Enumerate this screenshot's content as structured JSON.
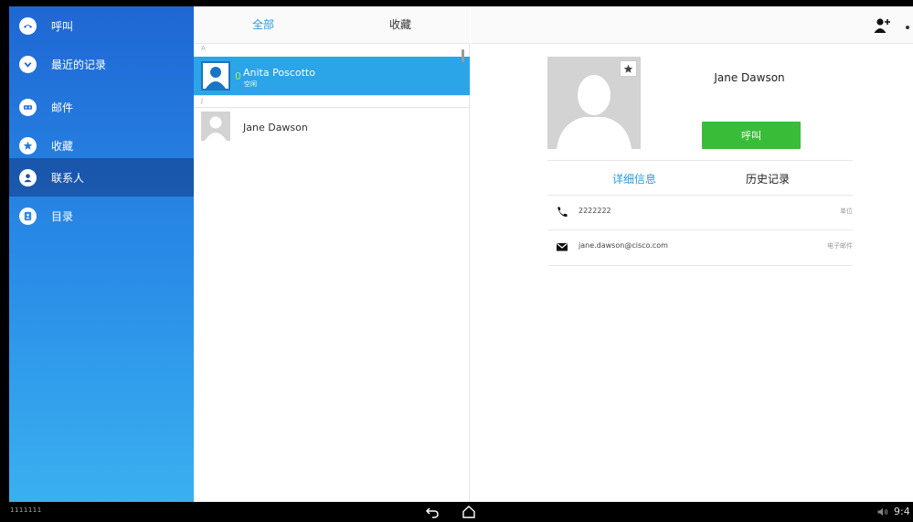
{
  "sidebar": {
    "items": [
      {
        "label": "呼叫",
        "icon": "phone-icon"
      },
      {
        "label": "最近的记录",
        "icon": "recents-icon"
      },
      {
        "label": "邮件",
        "icon": "voicemail-icon"
      },
      {
        "label": "收藏",
        "icon": "star-icon"
      },
      {
        "label": "联系人",
        "icon": "person-icon"
      },
      {
        "label": "目录",
        "icon": "directory-icon"
      }
    ],
    "active_index": 4
  },
  "list": {
    "tabs": {
      "all": "全部",
      "favorites": "收藏"
    },
    "sections": [
      {
        "letter": "A",
        "contacts": [
          {
            "name": "Anita Poscotto",
            "status": "空闲",
            "status_digit": "0",
            "selected": true
          }
        ]
      },
      {
        "letter": "J",
        "contacts": [
          {
            "name": "Jane Dawson",
            "selected": false
          }
        ]
      }
    ]
  },
  "detail": {
    "name": "Jane Dawson",
    "call_label": "呼叫",
    "tabs": {
      "info": "详细信息",
      "history": "历史记录"
    },
    "entries": [
      {
        "icon": "phone-icon",
        "value": "2222222",
        "type": "单位"
      },
      {
        "icon": "email-icon",
        "value": "jane.dawson@cisco.com",
        "type": "电子邮件"
      }
    ]
  },
  "system_bar": {
    "note": "1111111",
    "time": "9:4"
  },
  "colors": {
    "accent": "#2e9bd8",
    "call_green": "#39bd38",
    "selected_row": "#2ba4e8",
    "sidebar_top": "#1f67d4"
  }
}
